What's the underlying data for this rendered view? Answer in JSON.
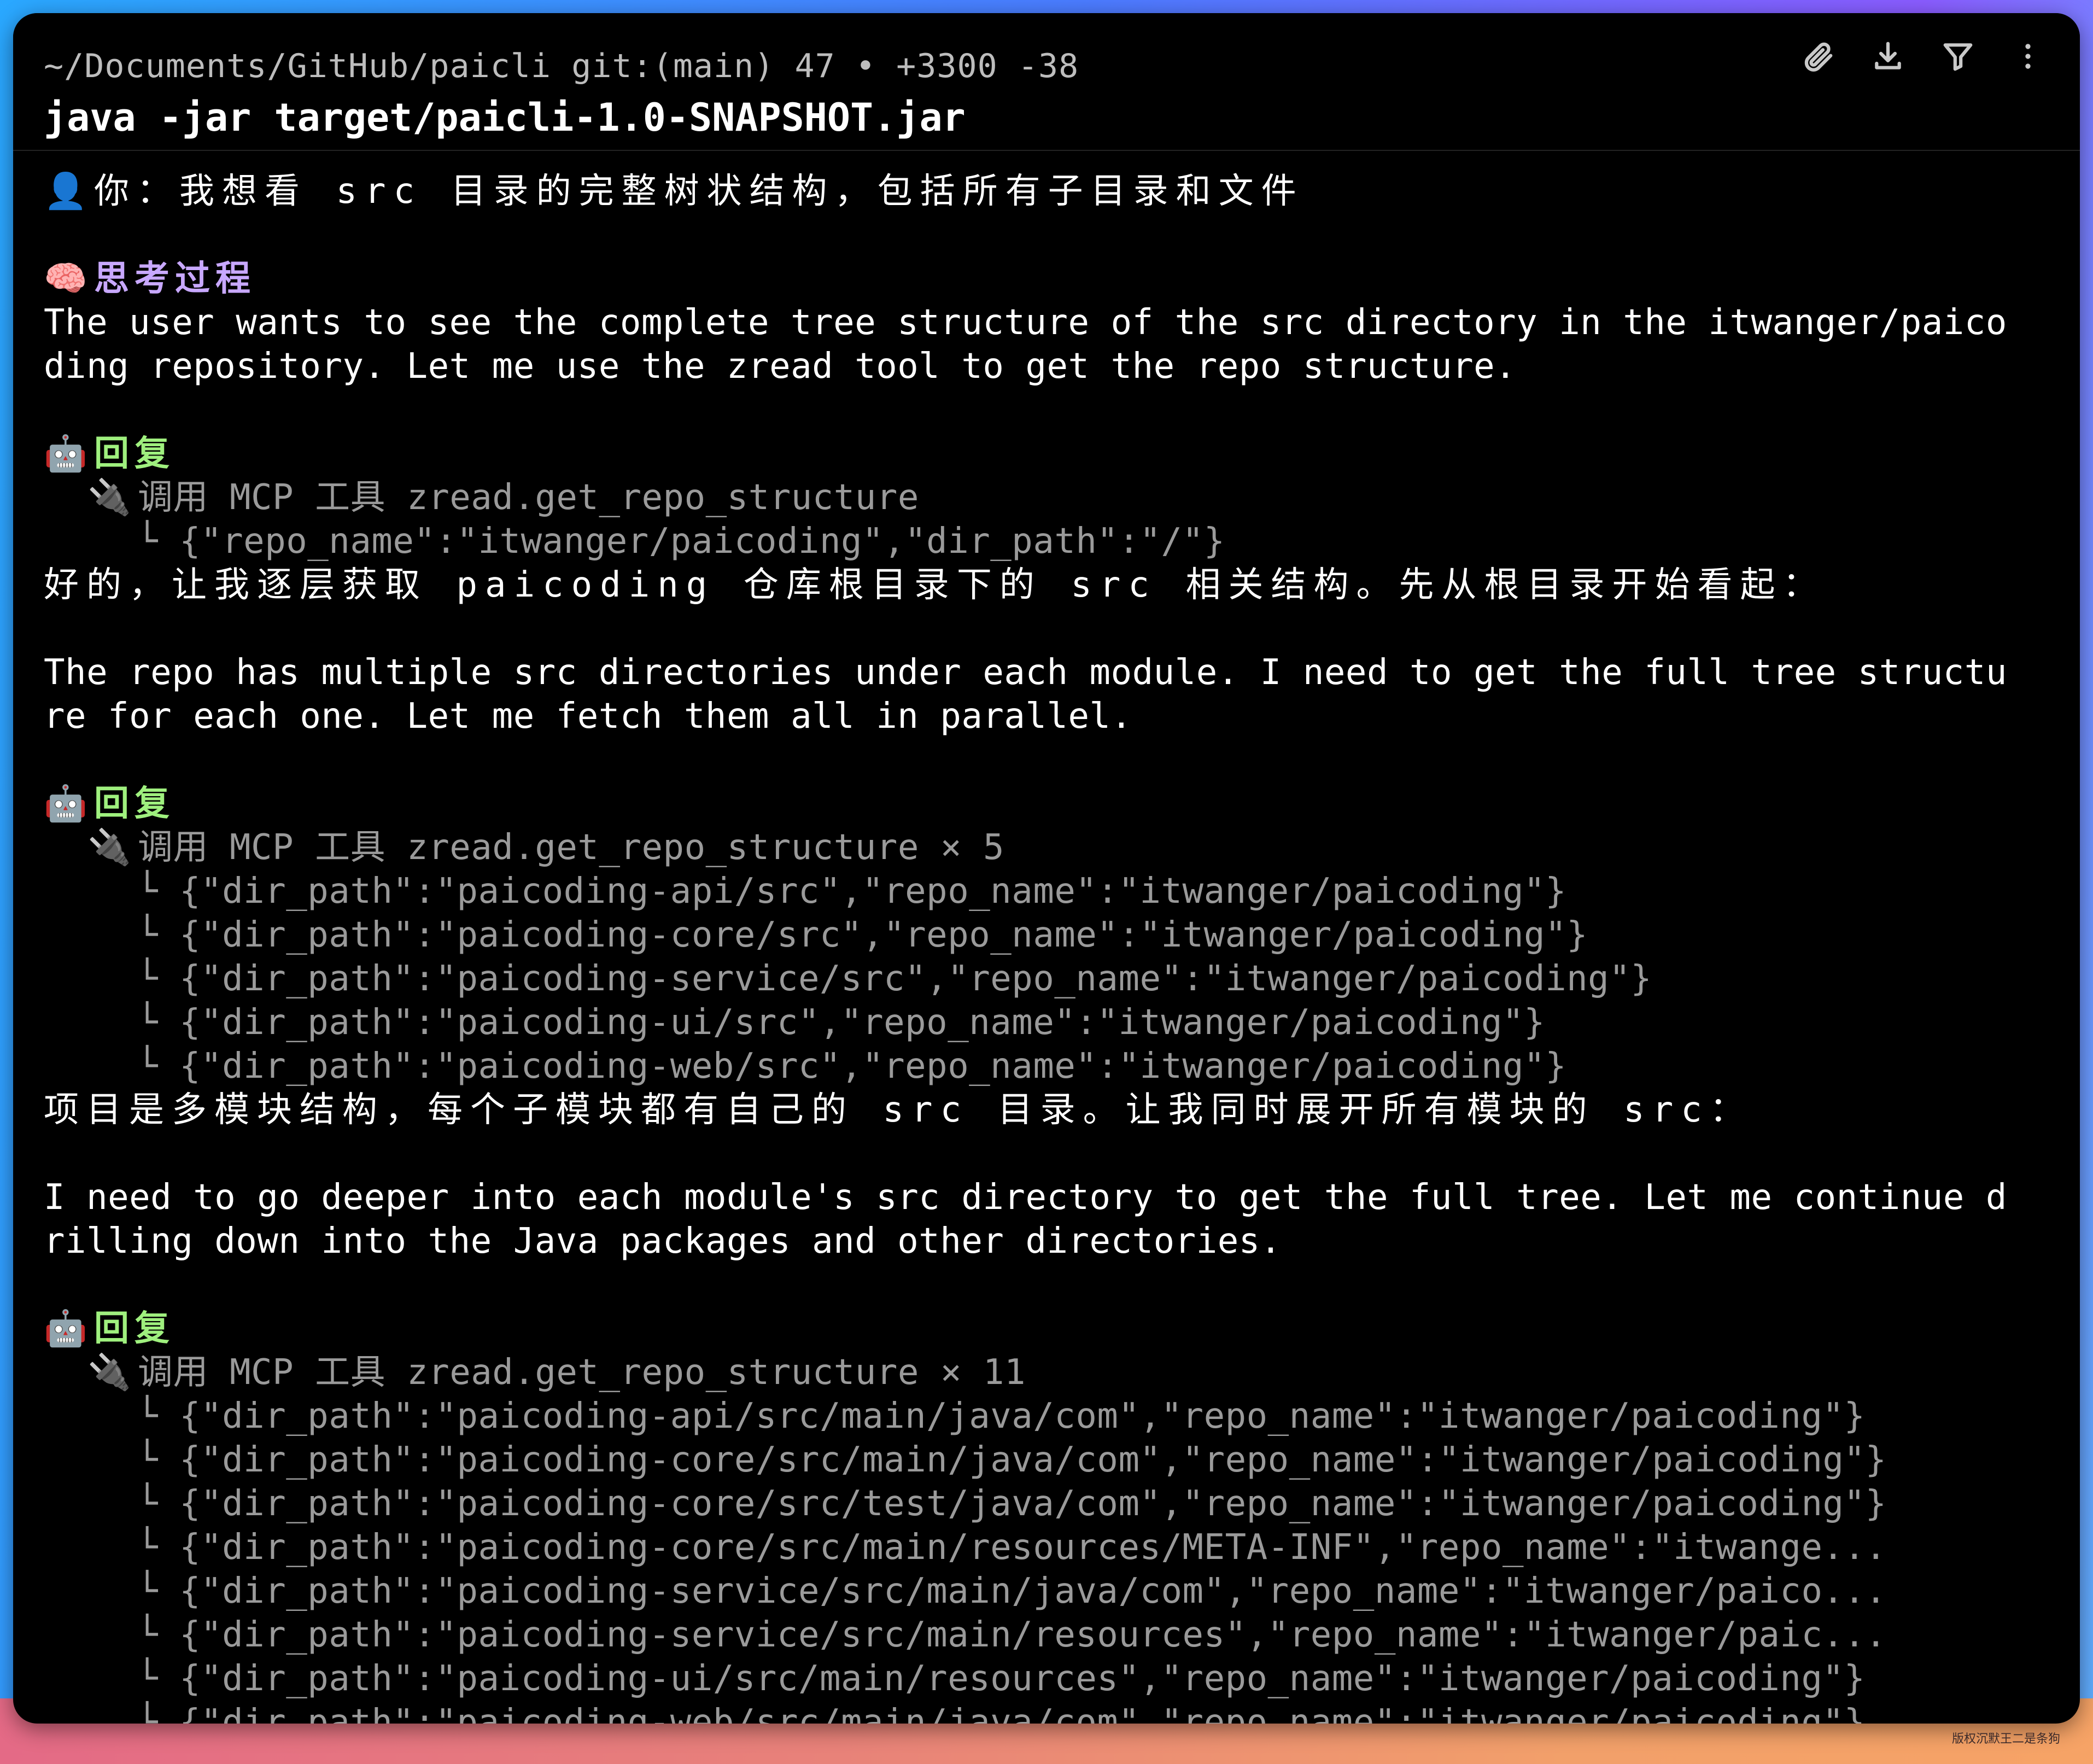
{
  "header": {
    "cwd": "~/Documents/GitHub/paicli git:(main) 47 • +3300 -38",
    "command": "java -jar target/paicli-1.0-SNAPSHOT.jar"
  },
  "icons": {
    "attach": "paperclip-icon",
    "download": "download-icon",
    "filter": "filter-icon",
    "menu": "more-vertical-icon",
    "user": "user-silhouette-icon",
    "brain": "brain-icon",
    "robot": "robot-icon",
    "plug": "plug-icon"
  },
  "colors": {
    "reply_heading": "#9ff07e",
    "think_heading": "#c8a8ff",
    "dim_text": "#9a9a9a",
    "terminal_bg": "#000000"
  },
  "transcript": {
    "user_prompt": "你：我想看 src 目录的完整树状结构，包括所有子目录和文件",
    "thinking": {
      "title": "思考过程",
      "lines": [
        "The user wants to see the complete tree structure of the src directory in the itwanger/paico",
        "ding repository. Let me use the zread tool to get the repo structure."
      ]
    },
    "reply1": {
      "title": "回复",
      "tool_call": "调用 MCP 工具 zread.get_repo_structure",
      "args": [
        "└ {\"repo_name\":\"itwanger/paicoding\",\"dir_path\":\"/\"}"
      ],
      "text_cn": "好的，让我逐层获取 paicoding 仓库根目录下的 src 相关结构。先从根目录开始看起：",
      "text_en": [
        "The repo has multiple src directories under each module. I need to get the full tree structu",
        "re for each one. Let me fetch them all in parallel."
      ]
    },
    "reply2": {
      "title": "回复",
      "tool_call": "调用 MCP 工具 zread.get_repo_structure × 5",
      "args": [
        "└ {\"dir_path\":\"paicoding-api/src\",\"repo_name\":\"itwanger/paicoding\"}",
        "└ {\"dir_path\":\"paicoding-core/src\",\"repo_name\":\"itwanger/paicoding\"}",
        "└ {\"dir_path\":\"paicoding-service/src\",\"repo_name\":\"itwanger/paicoding\"}",
        "└ {\"dir_path\":\"paicoding-ui/src\",\"repo_name\":\"itwanger/paicoding\"}",
        "└ {\"dir_path\":\"paicoding-web/src\",\"repo_name\":\"itwanger/paicoding\"}"
      ],
      "text_cn": "项目是多模块结构，每个子模块都有自己的 src 目录。让我同时展开所有模块的 src：",
      "text_en": [
        "I need to go deeper into each module's src directory to get the full tree. Let me continue d",
        "rilling down into the Java packages and other directories."
      ]
    },
    "reply3": {
      "title": "回复",
      "tool_call": "调用 MCP 工具 zread.get_repo_structure × 11",
      "args": [
        "└ {\"dir_path\":\"paicoding-api/src/main/java/com\",\"repo_name\":\"itwanger/paicoding\"}",
        "└ {\"dir_path\":\"paicoding-core/src/main/java/com\",\"repo_name\":\"itwanger/paicoding\"}",
        "└ {\"dir_path\":\"paicoding-core/src/test/java/com\",\"repo_name\":\"itwanger/paicoding\"}",
        "└ {\"dir_path\":\"paicoding-core/src/main/resources/META-INF\",\"repo_name\":\"itwange...",
        "└ {\"dir_path\":\"paicoding-service/src/main/java/com\",\"repo_name\":\"itwanger/paico...",
        "└ {\"dir_path\":\"paicoding-service/src/main/resources\",\"repo_name\":\"itwanger/paic...",
        "└ {\"dir_path\":\"paicoding-ui/src/main/resources\",\"repo_name\":\"itwanger/paicoding\"}",
        "└ {\"dir_path\":\"paicoding-web/src/main/java/com\",\"repo_name\":\"itwanger/paicoding\"}"
      ]
    }
  },
  "watermark": "版权沉默王二是条狗"
}
